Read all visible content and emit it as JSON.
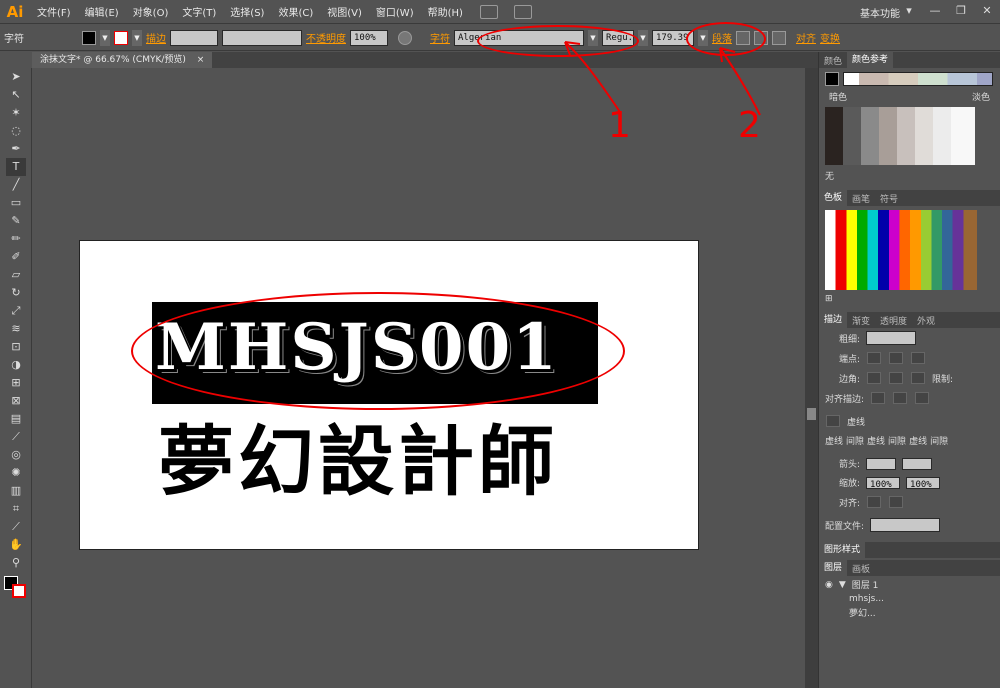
{
  "app": {
    "logo": "Ai",
    "workspace": "基本功能"
  },
  "menu": [
    "文件(F)",
    "编辑(E)",
    "对象(O)",
    "文字(T)",
    "选择(S)",
    "效果(C)",
    "视图(V)",
    "窗口(W)",
    "帮助(H)"
  ],
  "control_bar": {
    "mode_label": "字符",
    "stroke_label": "描边",
    "opacity_label": "不透明度",
    "opacity_value": "100%",
    "char_label": "字符",
    "font_family": "Algerian",
    "font_style": "Regu..",
    "font_size": "179.39",
    "para_label": "段落",
    "align_label": "对齐",
    "transform_label": "变换"
  },
  "document": {
    "tab_title": "涂抹文字* @ 66.67% (CMYK/预览)",
    "close": "×"
  },
  "artboard": {
    "selected_text": "MHSJS001",
    "cn_text": "夢幻設計師"
  },
  "annotations": {
    "num1": "1",
    "num2": "2"
  },
  "color_guide": {
    "tabs": [
      "颜色",
      "颜色参考"
    ],
    "dark_label": "暗色",
    "light_label": "淡色",
    "none_label": "无"
  },
  "swatches": {
    "tabs": [
      "色板",
      "画笔",
      "符号"
    ]
  },
  "stroke_panel": {
    "tabs": [
      "描边",
      "渐变",
      "透明度",
      "外观"
    ],
    "weight_label": "粗细:",
    "cap_label": "端点:",
    "corner_label": "边角:",
    "limit_label": "限制:",
    "align_label": "对齐描边:",
    "dashed_label": "虚线",
    "dash_labels": [
      "虚线",
      "间隙",
      "虚线",
      "间隙",
      "虚线",
      "间隙"
    ],
    "arrow_label": "箭头:",
    "scale_label": "缩放:",
    "scale_value1": "100%",
    "scale_value2": "100%",
    "align2_label": "对齐:",
    "profile_label": "配置文件:"
  },
  "graphic_styles": {
    "tab": "图形样式"
  },
  "layers": {
    "tabs": [
      "图层",
      "画板"
    ],
    "layer_name": "图层 1",
    "items": [
      "mhsjs...",
      "夢幻..."
    ]
  },
  "colors": {
    "accent": "#ff9a00",
    "annotation": "#e00000"
  }
}
